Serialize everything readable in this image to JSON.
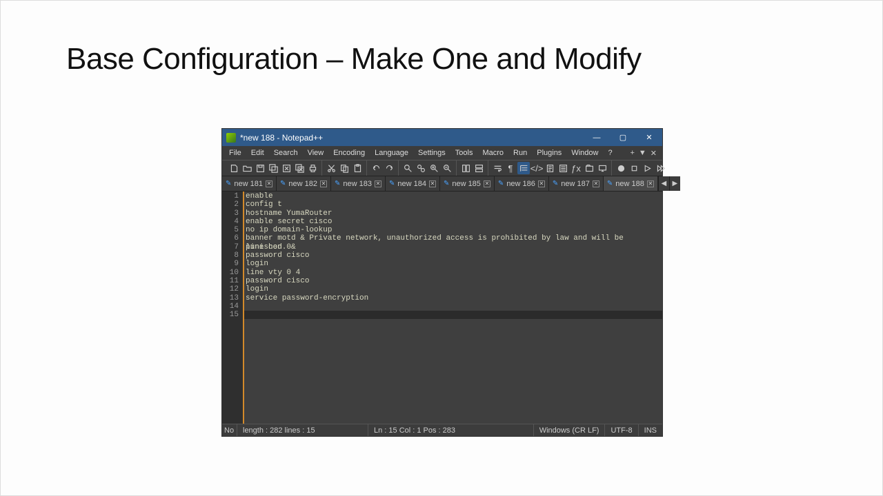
{
  "slide": {
    "title": "Base Configuration – Make One and Modify"
  },
  "window": {
    "title": "*new 188 - Notepad++",
    "controls": {
      "min": "—",
      "max": "▢",
      "close": "✕"
    }
  },
  "menus": [
    "File",
    "Edit",
    "Search",
    "View",
    "Encoding",
    "Language",
    "Settings",
    "Tools",
    "Macro",
    "Run",
    "Plugins",
    "Window",
    "?"
  ],
  "tabs": [
    {
      "label": "new 181"
    },
    {
      "label": "new 182"
    },
    {
      "label": "new 183"
    },
    {
      "label": "new 184"
    },
    {
      "label": "new 185"
    },
    {
      "label": "new 186"
    },
    {
      "label": "new 187"
    },
    {
      "label": "new 188",
      "active": true
    }
  ],
  "code_lines": [
    "enable",
    "config t",
    "hostname YumaRouter",
    "enable secret cisco",
    "no ip domain-lookup",
    "banner motd & Private network, unauthorized access is prohibited by law and will be punished. &",
    "line con 0",
    "password cisco",
    "login",
    "line vty 0 4",
    "password cisco",
    "login",
    "service password-encryption",
    "",
    ""
  ],
  "status": {
    "left1": "No",
    "left2": "length : 282    lines : 15",
    "center": "Ln : 15    Col : 1    Pos : 283",
    "eol": "Windows (CR LF)",
    "enc": "UTF-8",
    "ins": "INS"
  }
}
